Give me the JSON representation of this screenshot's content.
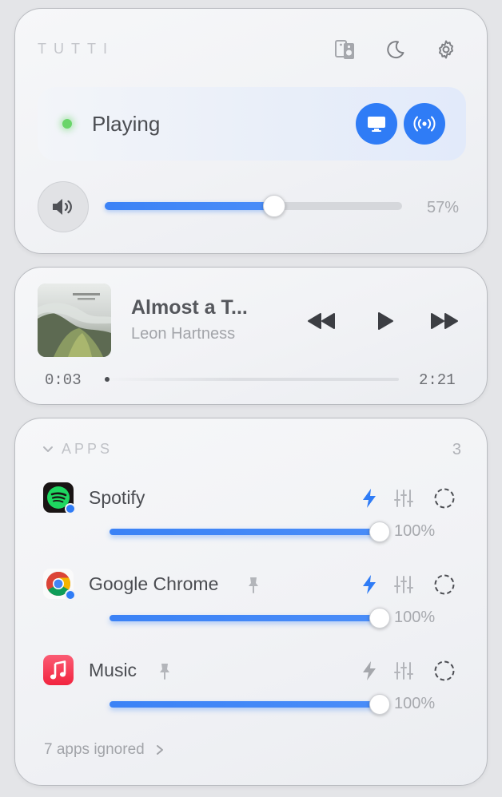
{
  "header": {
    "brand": "TUTTI",
    "icons": [
      "speaker-switch-icon",
      "moon-icon",
      "gear-icon"
    ]
  },
  "status": {
    "label": "Playing",
    "dot_color": "#6ad56a",
    "outputs": [
      "display-icon",
      "broadcast-icon"
    ]
  },
  "volume": {
    "level": 57,
    "label": "57%"
  },
  "now_playing": {
    "title": "Almost a T...",
    "artist": "Leon Hartness",
    "elapsed": "0:03",
    "duration": "2:21",
    "controls": [
      "rewind-icon",
      "play-icon",
      "fast-forward-icon"
    ]
  },
  "apps": {
    "header": "APPS",
    "count": "3",
    "items": [
      {
        "name": "Spotify",
        "volume": 100,
        "volume_label": "100%",
        "pinned": false,
        "boost_active": true
      },
      {
        "name": "Google Chrome",
        "volume": 100,
        "volume_label": "100%",
        "pinned": true,
        "boost_active": true
      },
      {
        "name": "Music",
        "volume": 100,
        "volume_label": "100%",
        "pinned": true,
        "boost_active": false
      }
    ],
    "ignored_label": "7 apps ignored"
  },
  "colors": {
    "accent": "#2f7cf6",
    "text": "#4b4d52",
    "muted": "#a7a9ae"
  }
}
